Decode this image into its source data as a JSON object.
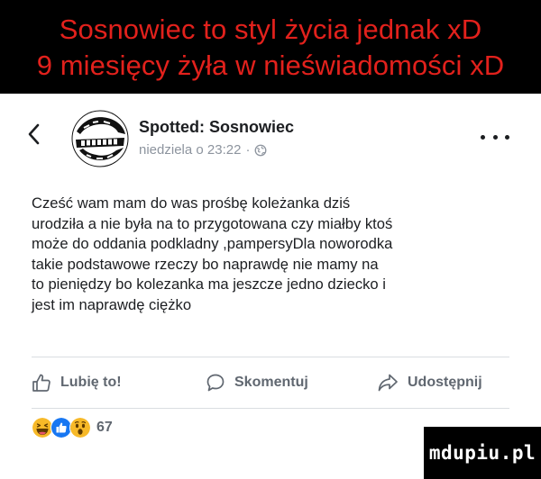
{
  "caption": {
    "line1": "Sosnowiec to styl życia jednak xD",
    "line2": "9 miesięcy żyła w nieświadomości xD"
  },
  "post": {
    "back_icon": "chevron-left-icon",
    "avatar_icon": "spotted-sosnowiec-logo",
    "page_name": "Spotted: Sosnowiec",
    "timestamp": "niedziela o 23:22",
    "separator": "·",
    "audience_icon": "globe-icon",
    "more_icon": "more-dots-icon",
    "body_lines": [
      "Cześć wam mam do was prośbę koleżanka dziś",
      "urodziła a nie była na to przygotowana czy miałby ktoś",
      "może do oddania podkladny ,pampersyDla noworodka",
      "takie podstawowe rzeczy bo naprawdę nie mamy na",
      "to pieniędzy bo kolezanka ma jeszcze jedno dziecko i",
      "jest im naprawdę ciężko"
    ]
  },
  "actions": {
    "like_label": "Lubię to!",
    "like_icon": "thumbs-up-icon",
    "comment_label": "Skomentuj",
    "comment_icon": "comment-bubble-icon",
    "share_label": "Udostępnij",
    "share_icon": "share-arrow-icon"
  },
  "reactions": {
    "icons": [
      "haha-reaction-icon",
      "like-reaction-icon",
      "wow-reaction-icon"
    ],
    "count": "67"
  },
  "watermark": {
    "text": "mdupiu.pl"
  },
  "colors": {
    "caption_background": "#000000",
    "caption_text": "#e2211c",
    "secondary_text": "#8d949e",
    "action_text": "#606770",
    "like_blue": "#1877f2",
    "reaction_yellow": "#f7b928"
  }
}
